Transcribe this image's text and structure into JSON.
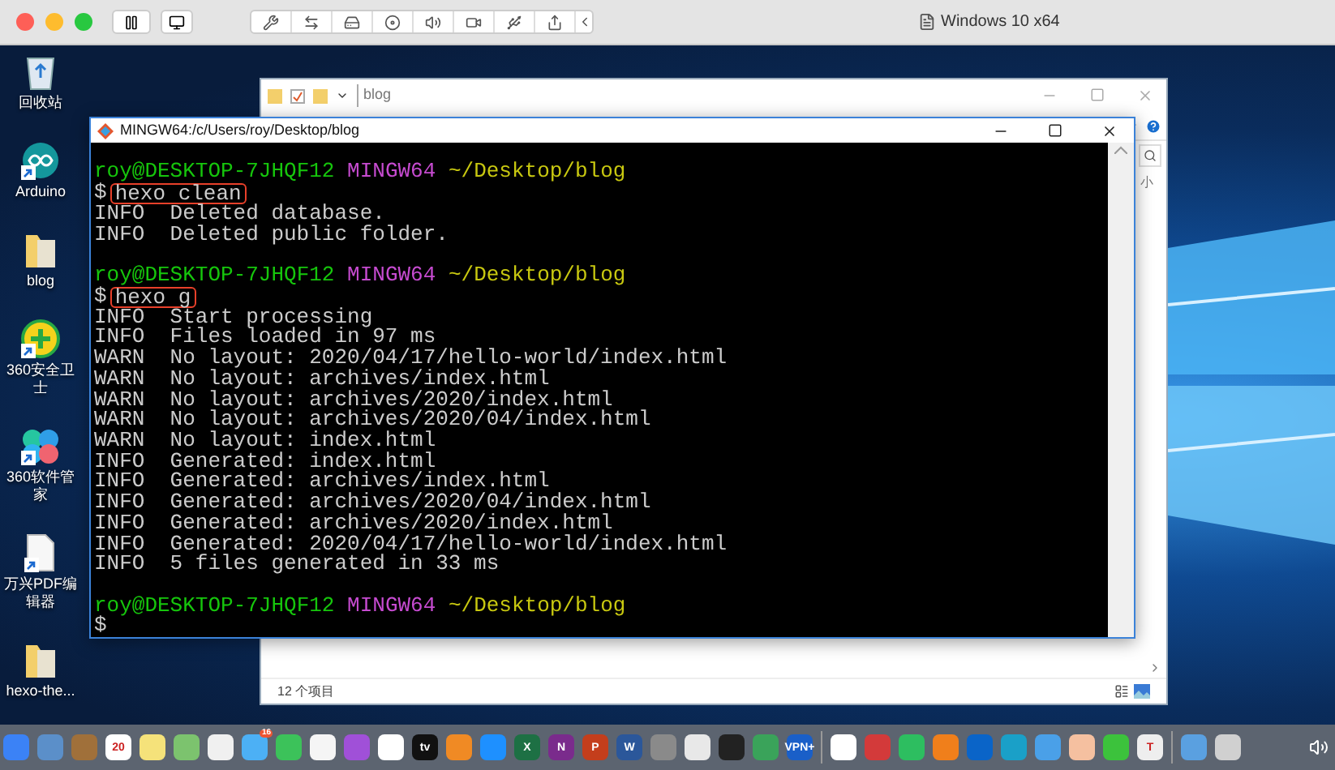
{
  "host_window": {
    "title": "Windows 10 x64"
  },
  "desktop_icons": [
    {
      "kind": "recycle",
      "label": "回收站",
      "shortcut": false
    },
    {
      "kind": "circle",
      "label": "Arduino",
      "shortcut": true
    },
    {
      "kind": "folder",
      "label": "blog",
      "shortcut": false
    },
    {
      "kind": "plus",
      "label": "360安全卫士",
      "shortcut": true
    },
    {
      "kind": "petals",
      "label": "360软件管家",
      "shortcut": true
    },
    {
      "kind": "document",
      "label": "万兴PDF编辑器",
      "shortcut": true
    },
    {
      "kind": "folder",
      "label": "hexo-the...",
      "shortcut": false
    }
  ],
  "explorer": {
    "title": "blog",
    "partial_text": "小",
    "status": "12 个项目"
  },
  "terminal": {
    "title": "MINGW64:/c/Users/roy/Desktop/blog",
    "lines": [
      {
        "kind": "prompt",
        "user": "roy@DESKTOP-7JHQF12",
        "system": "MINGW64",
        "path": "~/Desktop/blog"
      },
      {
        "kind": "command",
        "symbol": "$",
        "text": "hexo clean",
        "highlighted": true
      },
      {
        "kind": "log",
        "level": "INFO",
        "message": "Deleted database."
      },
      {
        "kind": "log",
        "level": "INFO",
        "message": "Deleted public folder."
      },
      {
        "kind": "blank"
      },
      {
        "kind": "prompt",
        "user": "roy@DESKTOP-7JHQF12",
        "system": "MINGW64",
        "path": "~/Desktop/blog"
      },
      {
        "kind": "command",
        "symbol": "$",
        "text": "hexo g",
        "highlighted": true
      },
      {
        "kind": "log",
        "level": "INFO",
        "message": "Start processing"
      },
      {
        "kind": "log",
        "level": "INFO",
        "message": "Files loaded in 97 ms"
      },
      {
        "kind": "log",
        "level": "WARN",
        "message": "No layout: 2020/04/17/hello-world/index.html"
      },
      {
        "kind": "log",
        "level": "WARN",
        "message": "No layout: archives/index.html"
      },
      {
        "kind": "log",
        "level": "WARN",
        "message": "No layout: archives/2020/index.html"
      },
      {
        "kind": "log",
        "level": "WARN",
        "message": "No layout: archives/2020/04/index.html"
      },
      {
        "kind": "log",
        "level": "WARN",
        "message": "No layout: index.html"
      },
      {
        "kind": "log",
        "level": "INFO",
        "message": "Generated: index.html"
      },
      {
        "kind": "log",
        "level": "INFO",
        "message": "Generated: archives/index.html"
      },
      {
        "kind": "log",
        "level": "INFO",
        "message": "Generated: archives/2020/04/index.html"
      },
      {
        "kind": "log",
        "level": "INFO",
        "message": "Generated: archives/2020/index.html"
      },
      {
        "kind": "log",
        "level": "INFO",
        "message": "Generated: 2020/04/17/hello-world/index.html"
      },
      {
        "kind": "log",
        "level": "INFO",
        "message": "5 files generated in 33 ms"
      },
      {
        "kind": "blank"
      },
      {
        "kind": "prompt",
        "user": "roy@DESKTOP-7JHQF12",
        "system": "MINGW64",
        "path": "~/Desktop/blog"
      },
      {
        "kind": "command",
        "symbol": "$",
        "highlighted": false
      }
    ]
  },
  "dock": [
    {
      "color": "#3b82f6"
    },
    {
      "color": "#5b8fc9"
    },
    {
      "color": "#a0703a"
    },
    {
      "color": "#ffffff",
      "label": "20"
    },
    {
      "color": "#f5e27a"
    },
    {
      "color": "#7cc36e"
    },
    {
      "color": "#f0f0f0"
    },
    {
      "color": "#4cb0f5",
      "badge": "16"
    },
    {
      "color": "#3cc25a"
    },
    {
      "color": "#f5f5f5"
    },
    {
      "color": "#a050d8"
    },
    {
      "color": "#ffffff"
    },
    {
      "color": "#111111",
      "label": "tv"
    },
    {
      "color": "#f08a24"
    },
    {
      "color": "#1e90ff"
    },
    {
      "color": "#1d7044",
      "label": "X"
    },
    {
      "color": "#7a2b8c",
      "label": "N"
    },
    {
      "color": "#c43e1c",
      "label": "P"
    },
    {
      "color": "#2b579a",
      "label": "W"
    },
    {
      "color": "#8a8a8a"
    },
    {
      "color": "#e8e8e8"
    },
    {
      "color": "#222222"
    },
    {
      "color": "#3aa35a"
    },
    {
      "color": "#1a5fc8",
      "label": "VPN+"
    },
    {
      "color": "#ffffff",
      "separator": true
    },
    {
      "color": "#d33a3a"
    },
    {
      "color": "#2dbe60"
    },
    {
      "color": "#f07f1b"
    },
    {
      "color": "#0a64c8"
    },
    {
      "color": "#1aa0c8"
    },
    {
      "color": "#4aa0e8"
    },
    {
      "color": "#f5c0a0"
    },
    {
      "color": "#3cc23c"
    },
    {
      "color": "#eeeeee",
      "label": "T"
    },
    {
      "color": "#5aa0e0",
      "separator": true
    },
    {
      "color": "#d0d0d0"
    }
  ]
}
